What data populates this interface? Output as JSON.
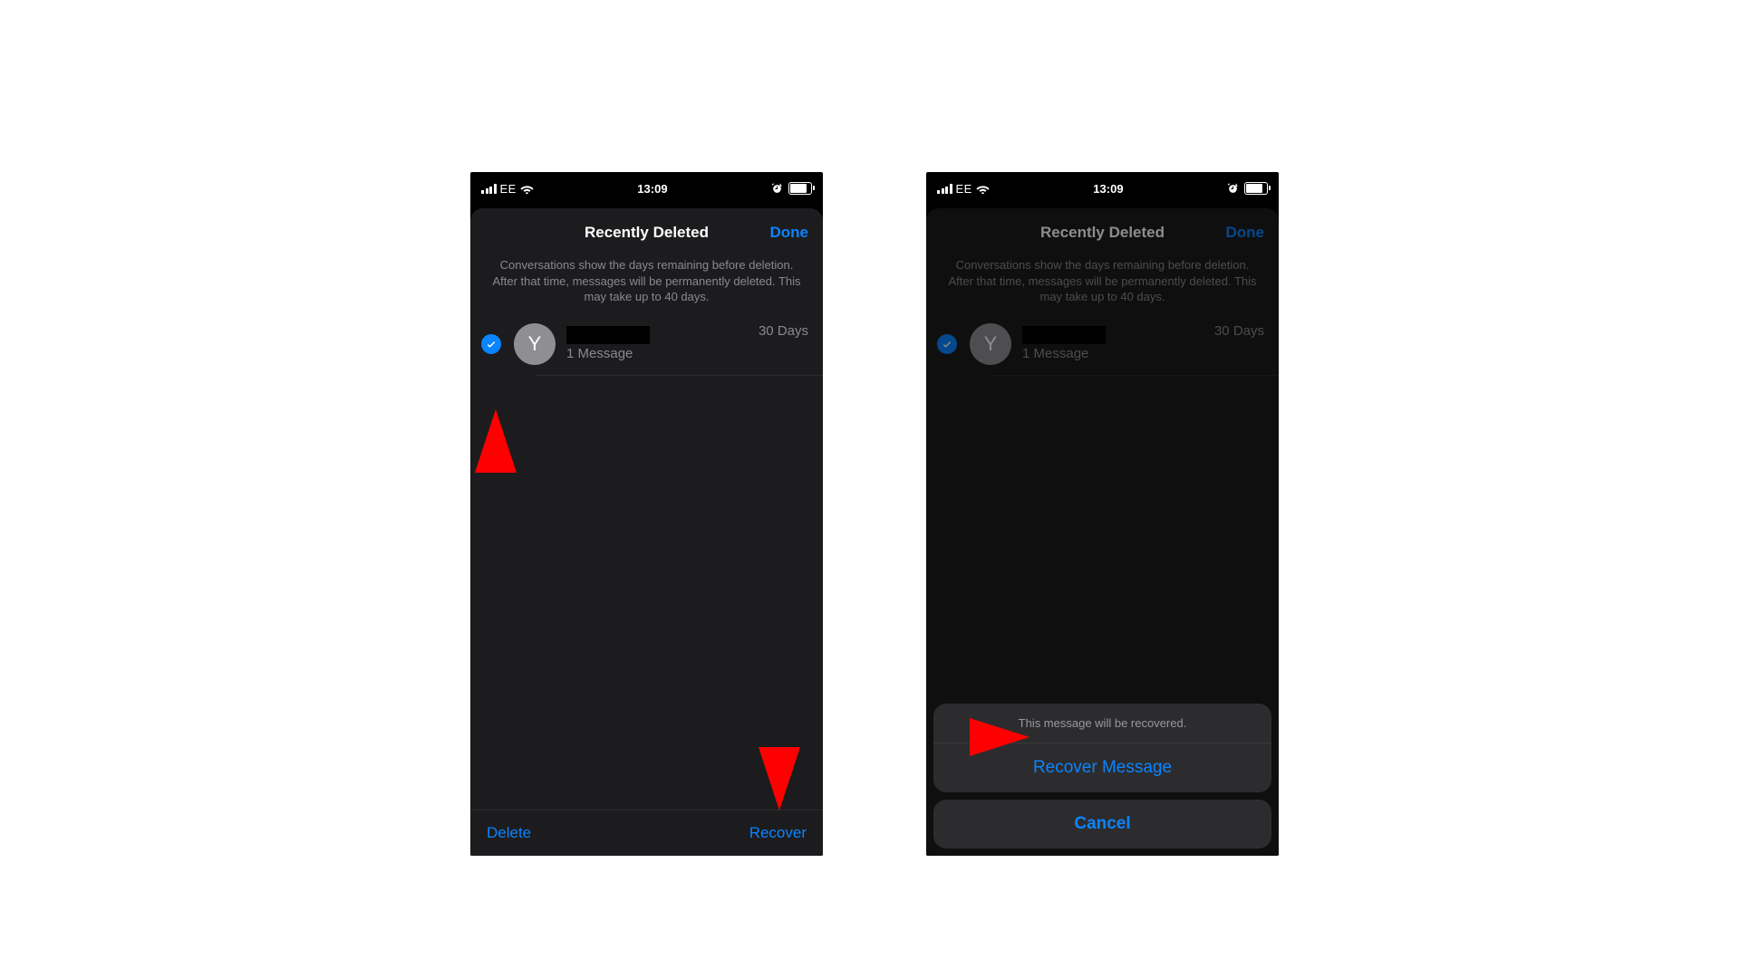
{
  "status": {
    "carrier": "EE",
    "time": "13:09"
  },
  "sheet": {
    "title": "Recently Deleted",
    "done": "Done",
    "info": "Conversations show the days remaining before deletion. After that time, messages will be permanently deleted. This may take up to 40 days."
  },
  "item": {
    "avatar_letter": "Y",
    "subtitle": "1 Message",
    "days": "30 Days"
  },
  "toolbar": {
    "delete": "Delete",
    "recover": "Recover"
  },
  "actionsheet": {
    "title": "This message will be recovered.",
    "recover": "Recover Message",
    "cancel": "Cancel"
  }
}
